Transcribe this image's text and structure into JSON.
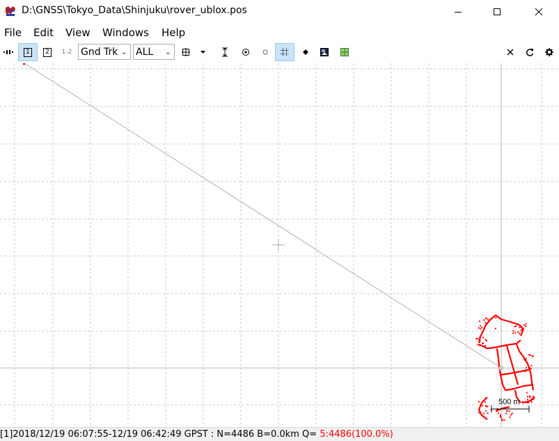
{
  "window": {
    "title": "D:\\GNSS\\Tokyo_Data\\Shinjuku\\rover_ublox.pos"
  },
  "menu": [
    "File",
    "Edit",
    "View",
    "Windows",
    "Help"
  ],
  "toolbar": {
    "plot_type": "Gnd Trk",
    "quality_filter": "ALL",
    "buttons": {
      "btn1": "1",
      "btn2": "2",
      "btn12": "1-2"
    }
  },
  "plot": {
    "scale_label": "500 m",
    "track_color": "#ff0000"
  },
  "status": {
    "prefix": "[1]2018/12/19 06:07:55-12/19 06:42:49 GPST : N=4486 B=0.0km Q= ",
    "quality": "5:4486(100.0%)",
    "quality_color": "#ff0000"
  }
}
